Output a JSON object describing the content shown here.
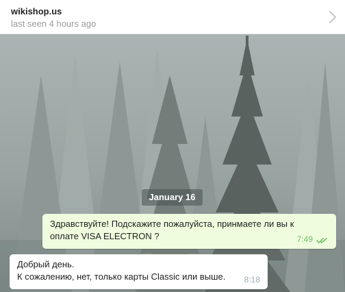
{
  "header": {
    "title": "wikishop.us",
    "status": "last seen 4 hours ago",
    "expand_icon": "chevron-right-icon"
  },
  "chat": {
    "background": "misty-pine-forest",
    "date_divider": "January 16",
    "messages": [
      {
        "direction": "outgoing",
        "lines": [
          "Здравствуйте! Подскажите пожалуйста, принмаете ли вы к",
          "оплате VISA ELECTRON ?"
        ],
        "time": "7:49",
        "status_icon": "double-check-icon"
      },
      {
        "direction": "incoming",
        "lines": [
          "Добрый день.",
          "К сожалению, нет, только карты Classic или выше."
        ],
        "time": "8:18"
      }
    ]
  },
  "colors": {
    "outgoing_bubble": "#effdde",
    "incoming_bubble": "#ffffff",
    "read_check": "#6cc264",
    "header_bg": "#ffffff"
  }
}
